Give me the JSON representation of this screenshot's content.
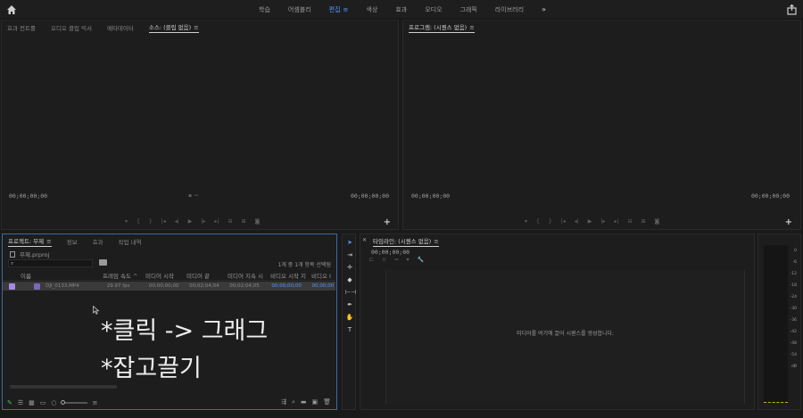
{
  "workspace": {
    "tabs": [
      "학습",
      "어셈블리",
      "편집",
      "색상",
      "효과",
      "오디오",
      "그래픽",
      "라이브러리"
    ],
    "active_tab": "편집",
    "more_label": "»"
  },
  "source_panel": {
    "tabs": [
      "효과 컨트롤",
      "오디오 클립 믹서",
      "메타데이터",
      "소스: (클립 없음)"
    ],
    "active_tab": "소스: (클립 없음)",
    "timecode_left": "00;00;00;00",
    "timecode_right": "00;00;00;00"
  },
  "program_panel": {
    "title": "프로그램: (시퀀스 없음)",
    "timecode_left": "00;00;00;00",
    "timecode_right": "00;00;00;00"
  },
  "project_panel": {
    "tabs": [
      "프로젝트: 무제",
      "정보",
      "효과",
      "작업 내역"
    ],
    "active_tab": "프로젝트: 무제",
    "project_file": "무제.prproj",
    "items_selected": "1개 중 1개 항목 선택됨",
    "columns": [
      "이름",
      "프레임 속도",
      "미디어 시작",
      "미디어 끝",
      "미디어 지속 시",
      "비디오 시작 지",
      "비디오 I"
    ],
    "rows": [
      {
        "name": "DJI_0133.MP4",
        "frame_rate": "29.97 fps",
        "media_start": "00;00;00;00",
        "media_end": "00;02;04;04",
        "media_duration": "00;02;04;05",
        "video_start": "00;00;00;00",
        "video_in": "00;00;00"
      }
    ]
  },
  "overlay_text": {
    "line1": "*클릭 -> 그래그",
    "line2": "*잡고끌기"
  },
  "timeline_panel": {
    "title": "타임라인: (시퀀스 없음)",
    "timecode": "00;00;00;00",
    "drop_hint": "미디어를 여기에 끌어 시퀀스를 생성합니다."
  },
  "audio_meter": {
    "scale": [
      "0",
      "-6",
      "-12",
      "-18",
      "-24",
      "-30",
      "-36",
      "-42",
      "-48",
      "-54",
      "dB"
    ],
    "peak_color": "#c8b400"
  },
  "colors": {
    "accent_blue": "#4f9bff",
    "focus_border": "#3d6aa6",
    "clip_purple": "#a58be0"
  }
}
